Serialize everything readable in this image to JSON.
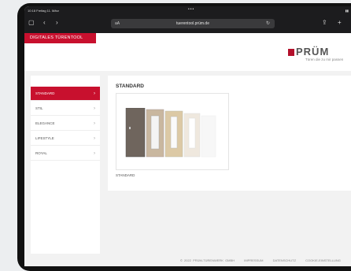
{
  "browser": {
    "status_time": "10:18  Freitag 11. März",
    "url": "tuerentool.prüm.de",
    "aa_label": "aA"
  },
  "header": {
    "tool_title": "DIGITALES TÜRENTOOL",
    "logo_text": "PRÜM",
    "logo_tagline": "Türen die zu mir passen"
  },
  "sidebar": {
    "items": [
      {
        "label": "STANDARD",
        "active": true
      },
      {
        "label": "STIL",
        "active": false
      },
      {
        "label": "ELEGANCE",
        "active": false
      },
      {
        "label": "LIFESTYLE",
        "active": false
      },
      {
        "label": "ROYAL",
        "active": false
      }
    ]
  },
  "main": {
    "title": "STANDARD",
    "product_label": "STANDARD"
  },
  "footer": {
    "copyright": "© 2022 PRÜM-TÜRENWERK GMBH",
    "links": [
      "IMPRESSUM",
      "DATENSCHUTZ",
      "COOKIE-EINSTELLUNG"
    ]
  },
  "colors": {
    "brand_red": "#c8102e",
    "browser_bar": "#1c1c1e"
  }
}
